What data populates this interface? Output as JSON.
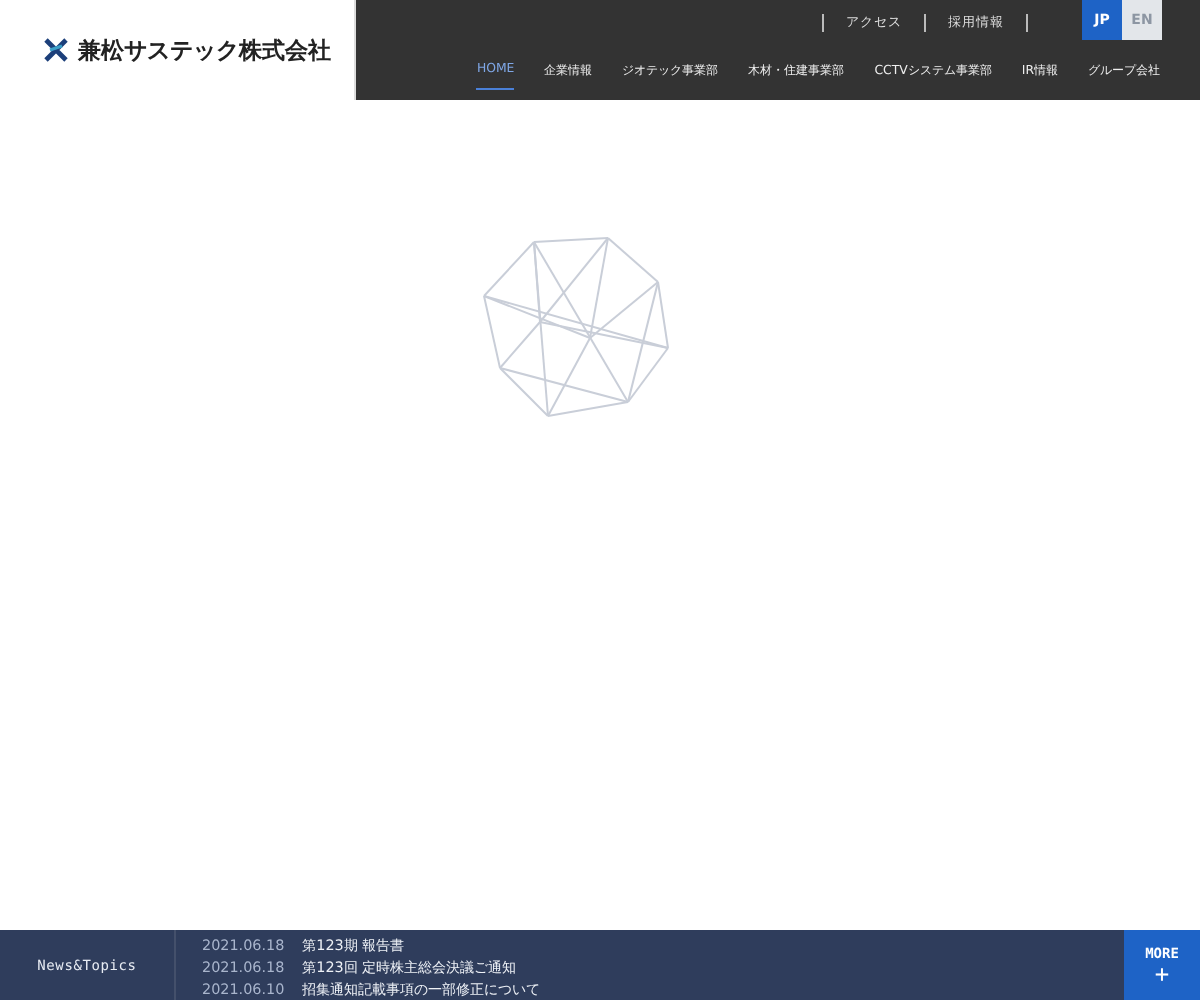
{
  "logo": {
    "text": "兼松サステック株式会社"
  },
  "utility_links": [
    "アクセス",
    "採用情報"
  ],
  "languages": [
    {
      "label": "JP",
      "selected": true
    },
    {
      "label": "EN",
      "selected": false
    }
  ],
  "nav": [
    {
      "label": "HOME",
      "selected": true
    },
    {
      "label": "企業情報",
      "selected": false
    },
    {
      "label": "ジオテック事業部",
      "selected": false
    },
    {
      "label": "木材・住建事業部",
      "selected": false
    },
    {
      "label": "CCTVシステム事業部",
      "selected": false
    },
    {
      "label": "IR情報",
      "selected": false
    },
    {
      "label": "グループ会社",
      "selected": false
    }
  ],
  "news": {
    "title": "News&Topics",
    "items": [
      {
        "date": "2021.06.18",
        "title": "第123期 報告書"
      },
      {
        "date": "2021.06.18",
        "title": "第123回 定時株主総会決議ご通知"
      },
      {
        "date": "2021.06.10",
        "title": "招集通知記載事項の一部修正について"
      }
    ],
    "more": {
      "label": "MORE",
      "icon": "+"
    }
  }
}
